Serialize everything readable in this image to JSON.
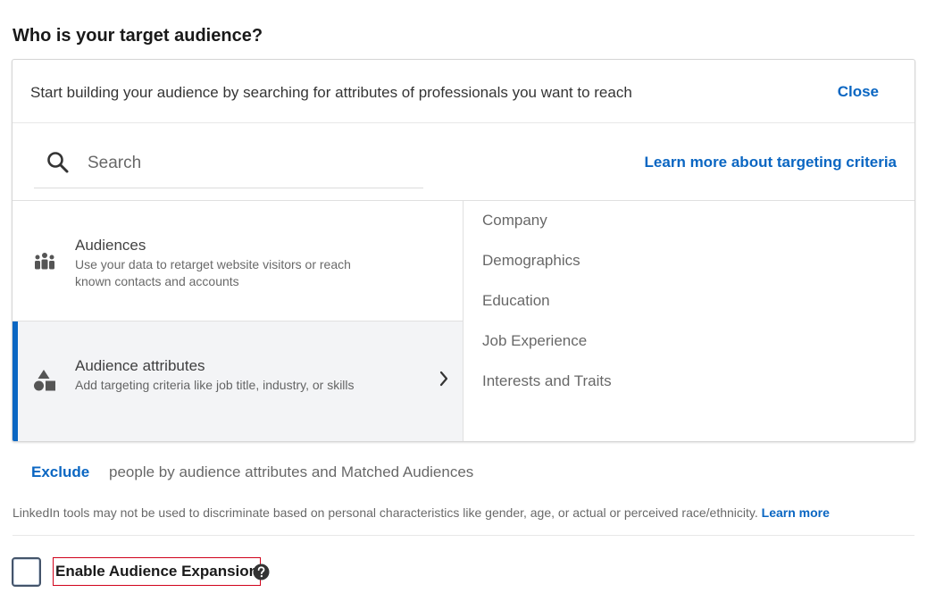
{
  "heading": "Who is your target audience?",
  "panel": {
    "intro": "Start building your audience by searching for attributes of professionals you want to reach",
    "close_label": "Close",
    "search": {
      "placeholder": "Search",
      "value": ""
    },
    "learn_criteria_label": "Learn more about targeting criteria",
    "options": [
      {
        "title": "Audiences",
        "description": "Use your data to retarget website visitors or reach known contacts and accounts",
        "icon": "people-group-icon"
      },
      {
        "title": "Audience attributes",
        "description": "Add targeting criteria like job title, industry, or skills",
        "icon": "shapes-icon",
        "selected": true
      }
    ],
    "categories": [
      "Company",
      "Demographics",
      "Education",
      "Job Experience",
      "Interests and Traits"
    ]
  },
  "exclude": {
    "link_label": "Exclude",
    "text": "people by audience attributes and Matched Audiences"
  },
  "disclaimer": {
    "text": "LinkedIn tools may not be used to discriminate based on personal characteristics like gender, age, or actual or perceived race/ethnicity.",
    "link_label": "Learn more"
  },
  "expansion": {
    "label": "Enable Audience Expansion",
    "checked": false
  },
  "colors": {
    "link": "#0a66c2",
    "selected_bar": "#0a66c2",
    "highlight_box": "#d0021b"
  }
}
